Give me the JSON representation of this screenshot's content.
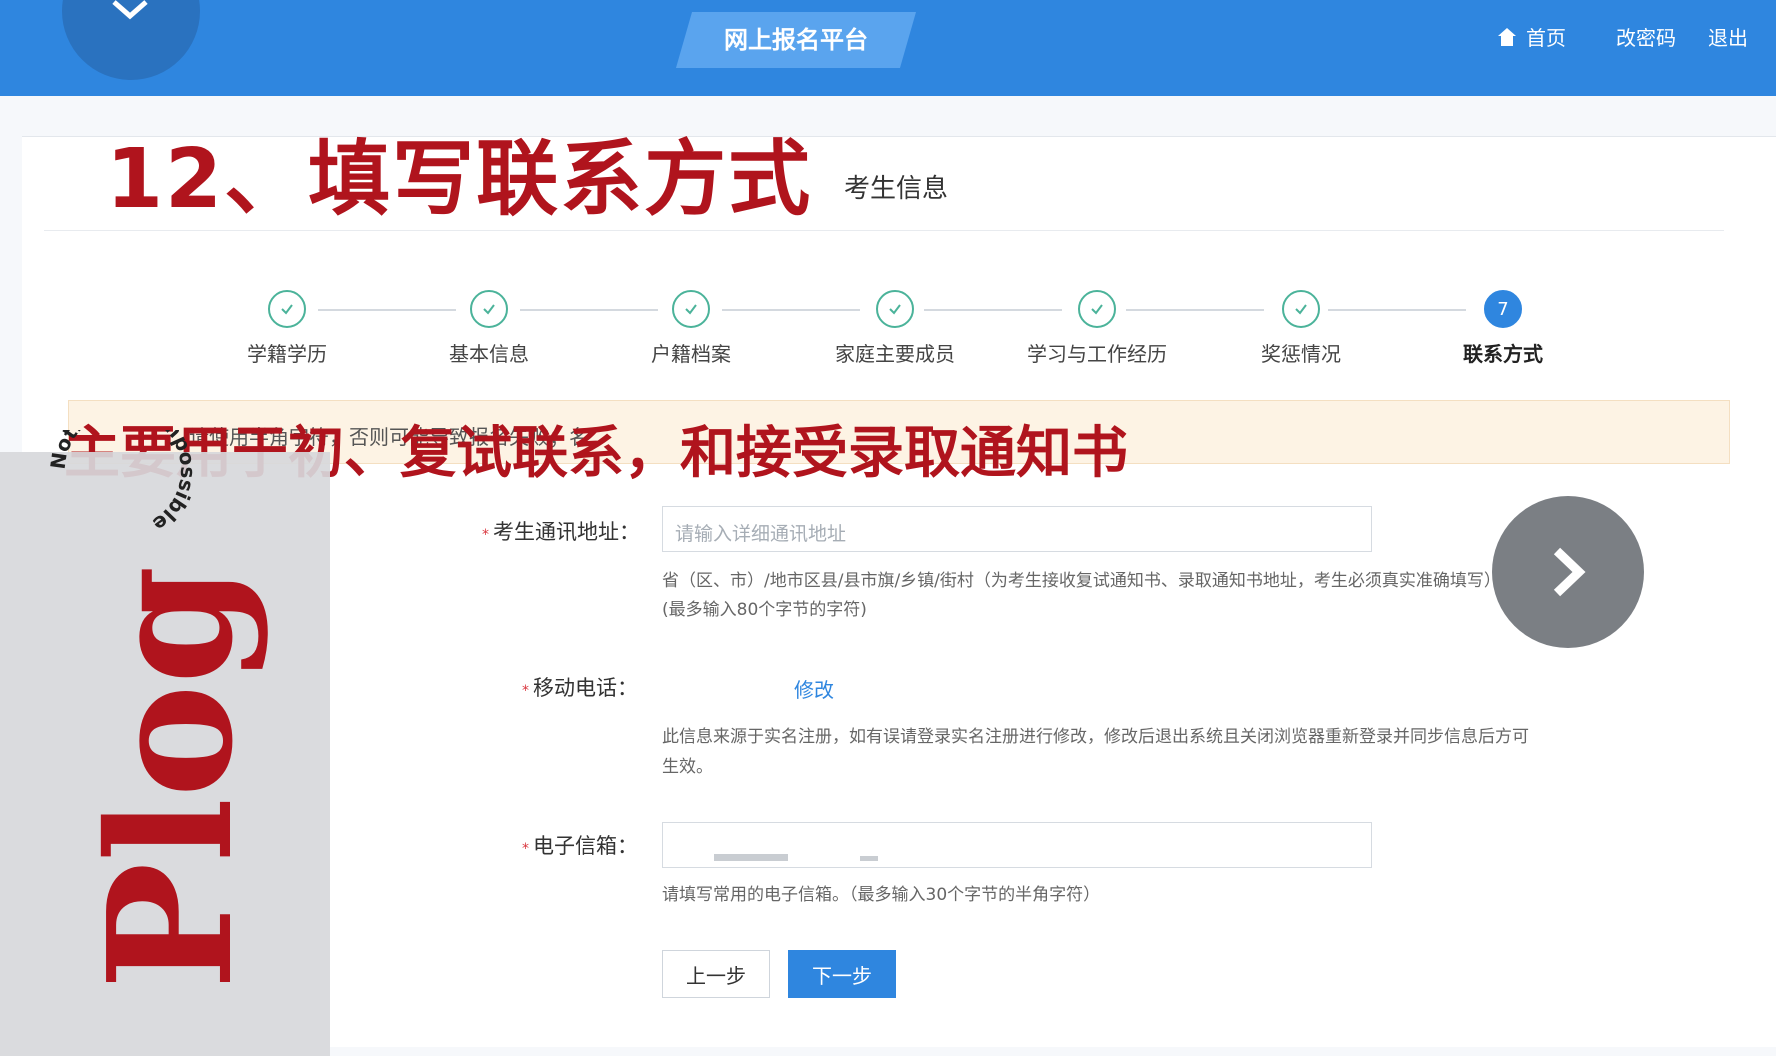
{
  "header": {
    "brand": "网上报名平台",
    "nav": {
      "home": "首页",
      "change_password": "改密码",
      "logout": "退出"
    }
  },
  "page": {
    "overlay_title": "12、填写联系方式",
    "section_title": "考生信息"
  },
  "steps": [
    {
      "label": "学籍学历",
      "status": "done"
    },
    {
      "label": "基本信息",
      "status": "done"
    },
    {
      "label": "户籍档案",
      "status": "done"
    },
    {
      "label": "家庭主要成员",
      "status": "done"
    },
    {
      "label": "学习与工作经历",
      "status": "done"
    },
    {
      "label": "奖惩情况",
      "status": "done"
    },
    {
      "label": "联系方式",
      "status": "active",
      "number": "7"
    }
  ],
  "notice": {
    "text": "请使用半角字符，否则可能导致报名失败；名",
    "overlay_caption": "主要用于初、复试联系，和接受录取通知书"
  },
  "form": {
    "address": {
      "label": "考生通讯地址：",
      "placeholder": "请输入详细通讯地址",
      "help_1": "省（区、市）/地市区县/县市旗/乡镇/街村（为考生接收复试通知书、录取通知书地址，考生必须真实准确填写）",
      "help_2": "(最多输入80个字节的字符)"
    },
    "mobile": {
      "label": "移动电话：",
      "edit_label": "修改",
      "help_1": "此信息来源于实名注册，如有误请登录实名注册进行修改，修改后退出系统且关闭浏览器重新登录并同步信息后方可",
      "help_2": "生效。"
    },
    "email": {
      "label": "电子信箱：",
      "help": "请填写常用的电子信箱。（最多输入30个字节的半角字符）"
    }
  },
  "buttons": {
    "prev": "上一步",
    "next": "下一步"
  },
  "watermark": {
    "circle_text": "Nothing is impossible",
    "big_text": "Plog"
  },
  "colors": {
    "primary": "#2f86df",
    "overlay_red": "#b0141d",
    "check_green": "#4bb39a"
  }
}
